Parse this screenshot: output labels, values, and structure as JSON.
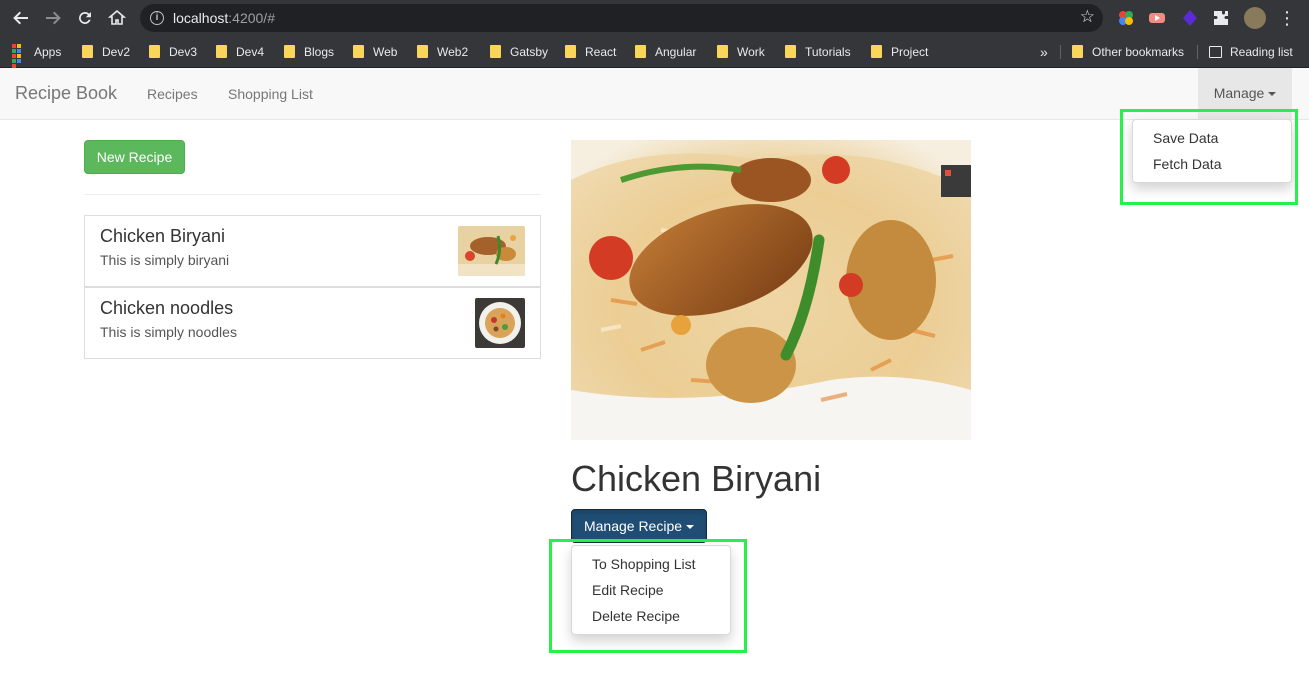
{
  "browser": {
    "url_host": "localhost",
    "url_rest": ":4200/#",
    "bookmarks": [
      "Apps",
      "Dev2",
      "Dev3",
      "Dev4",
      "Blogs",
      "Web",
      "Web2",
      "Gatsby",
      "React",
      "Angular",
      "Work",
      "Tutorials",
      "Project"
    ],
    "overflow": "»",
    "other_bookmarks": "Other bookmarks",
    "reading_list": "Reading list"
  },
  "navbar": {
    "brand": "Recipe Book",
    "links": [
      "Recipes",
      "Shopping List"
    ],
    "manage_label": "Manage",
    "manage_menu": [
      "Save Data",
      "Fetch Data"
    ]
  },
  "recipes": {
    "new_button": "New Recipe",
    "items": [
      {
        "name": "Chicken Biryani",
        "description": "This is simply biryani"
      },
      {
        "name": "Chicken noodles",
        "description": "This is simply noodles"
      }
    ]
  },
  "detail": {
    "title": "Chicken Biryani",
    "manage_button": "Manage Recipe",
    "manage_menu": [
      "To Shopping List",
      "Edit Recipe",
      "Delete Recipe"
    ]
  },
  "colors": {
    "success": "#5cb85c",
    "primary_active": "#204d74",
    "highlight": "#26f04a"
  }
}
